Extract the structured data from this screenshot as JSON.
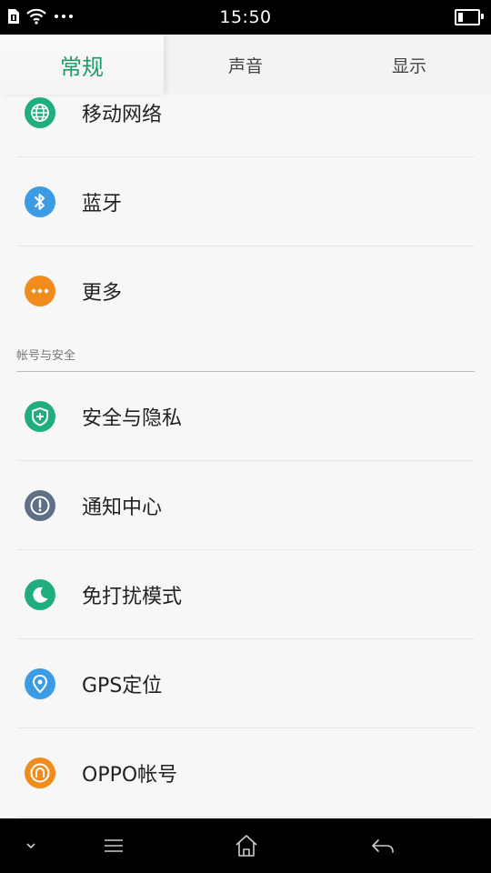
{
  "status_bar": {
    "time": "15:50",
    "battery_level": 0.25
  },
  "tabs": [
    {
      "label": "常规",
      "active": true
    },
    {
      "label": "声音",
      "active": false
    },
    {
      "label": "显示",
      "active": false
    }
  ],
  "settings": {
    "items_top": [
      {
        "label": "移动网络",
        "icon": "globe-icon",
        "color": "#1fae7c"
      },
      {
        "label": "蓝牙",
        "icon": "bluetooth-icon",
        "color": "#3c9be5"
      },
      {
        "label": "更多",
        "icon": "more-icon",
        "color": "#f08c1c"
      }
    ],
    "section_account_title": "帐号与安全",
    "items_account": [
      {
        "label": "安全与隐私",
        "icon": "shield-icon",
        "color": "#1fae7c"
      },
      {
        "label": "通知中心",
        "icon": "alert-icon",
        "color": "#5f6f86"
      },
      {
        "label": "免打扰模式",
        "icon": "moon-icon",
        "color": "#1fae7c"
      },
      {
        "label": "GPS定位",
        "icon": "location-pin-icon",
        "color": "#3c9be5"
      },
      {
        "label": "OPPO帐号",
        "icon": "account-icon",
        "color": "#f08c1c"
      }
    ]
  },
  "colors": {
    "accent": "#1f9b6a",
    "background": "#f7f7f7"
  }
}
